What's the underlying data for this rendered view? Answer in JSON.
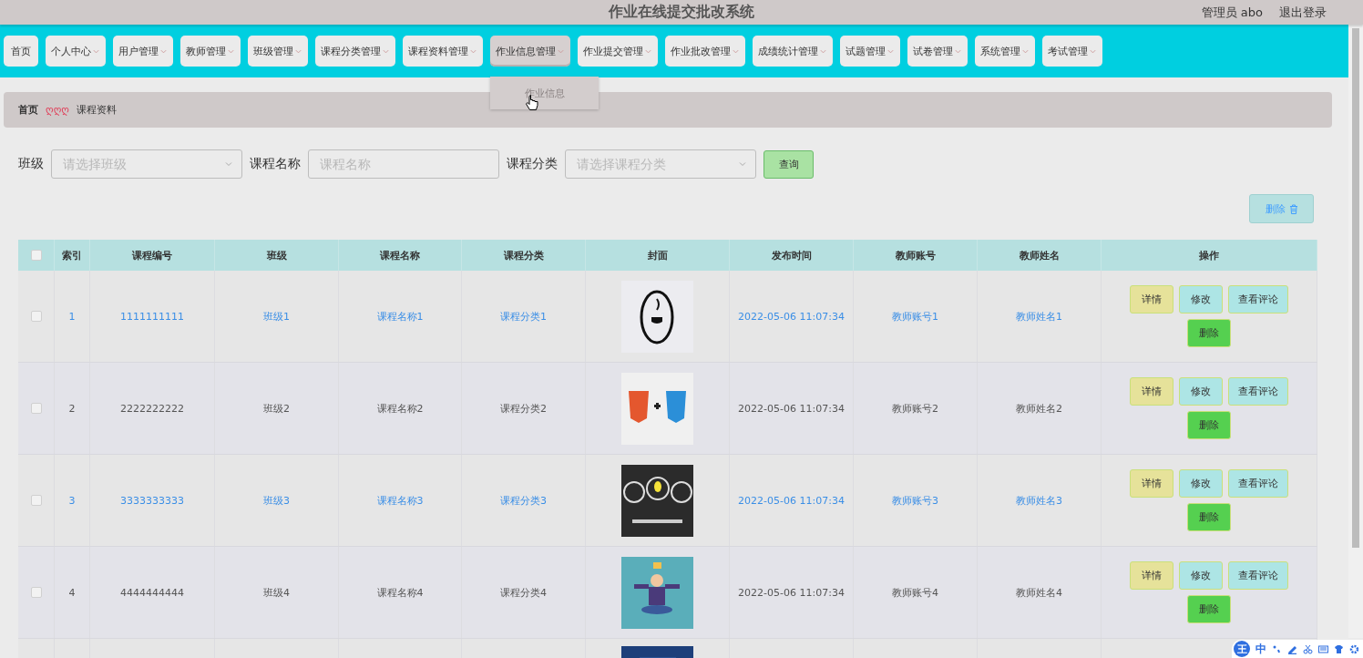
{
  "header": {
    "title": "作业在线提交批改系统",
    "user": "管理员 abo",
    "logout": "退出登录"
  },
  "nav": [
    {
      "label": "首页",
      "dropdown": false,
      "open": false
    },
    {
      "label": "个人中心",
      "dropdown": true,
      "open": false
    },
    {
      "label": "用户管理",
      "dropdown": true,
      "open": false
    },
    {
      "label": "教师管理",
      "dropdown": true,
      "open": false
    },
    {
      "label": "班级管理",
      "dropdown": true,
      "open": false
    },
    {
      "label": "课程分类管理",
      "dropdown": true,
      "open": false
    },
    {
      "label": "课程资料管理",
      "dropdown": true,
      "open": false
    },
    {
      "label": "作业信息管理",
      "dropdown": true,
      "open": true,
      "menu": [
        "作业信息"
      ]
    },
    {
      "label": "作业提交管理",
      "dropdown": true,
      "open": false
    },
    {
      "label": "作业批改管理",
      "dropdown": true,
      "open": false
    },
    {
      "label": "成绩统计管理",
      "dropdown": true,
      "open": false
    },
    {
      "label": "试题管理",
      "dropdown": true,
      "open": false
    },
    {
      "label": "试卷管理",
      "dropdown": true,
      "open": false
    },
    {
      "label": "系统管理",
      "dropdown": true,
      "open": false
    },
    {
      "label": "考试管理",
      "dropdown": true,
      "open": false
    }
  ],
  "breadcrumb": {
    "home": "首页",
    "separator": "ღღღ",
    "current": "课程资料"
  },
  "filters": [
    {
      "label": "班级",
      "kind": "select",
      "placeholder": "请选择班级"
    },
    {
      "label": "课程名称",
      "kind": "input",
      "placeholder": "课程名称"
    },
    {
      "label": "课程分类",
      "kind": "select",
      "placeholder": "请选择课程分类"
    }
  ],
  "search_button": "查询",
  "delete_button": "删除",
  "table": {
    "select_all_checked": false,
    "columns": [
      "索引",
      "课程编号",
      "班级",
      "课程名称",
      "课程分类",
      "封面",
      "发布时间",
      "教师账号",
      "教师姓名",
      "操作"
    ],
    "rows": [
      {
        "checked": false,
        "highlighted": true,
        "index": "1",
        "code": "1111111111",
        "class": "班级1",
        "name": "课程名称1",
        "category": "课程分类1",
        "time": "2022-05-06 11:07:34",
        "account": "教师账号1",
        "teacher": "教师姓名1",
        "actions": [
          "详情",
          "修改",
          "查看评论",
          "删除"
        ]
      },
      {
        "checked": false,
        "highlighted": false,
        "index": "2",
        "code": "2222222222",
        "class": "班级2",
        "name": "课程名称2",
        "category": "课程分类2",
        "time": "2022-05-06 11:07:34",
        "account": "教师账号2",
        "teacher": "教师姓名2",
        "actions": [
          "详情",
          "修改",
          "查看评论",
          "删除"
        ]
      },
      {
        "checked": false,
        "highlighted": true,
        "index": "3",
        "code": "3333333333",
        "class": "班级3",
        "name": "课程名称3",
        "category": "课程分类3",
        "time": "2022-05-06 11:07:34",
        "account": "教师账号3",
        "teacher": "教师姓名3",
        "actions": [
          "详情",
          "修改",
          "查看评论",
          "删除"
        ]
      },
      {
        "checked": false,
        "highlighted": false,
        "index": "4",
        "code": "4444444444",
        "class": "班级4",
        "name": "课程名称4",
        "category": "课程分类4",
        "time": "2022-05-06 11:07:34",
        "account": "教师账号4",
        "teacher": "教师姓名4",
        "actions": [
          "详情",
          "修改",
          "查看评论",
          "删除"
        ]
      }
    ]
  },
  "ime_bar": {
    "logo": "王",
    "mode": "中"
  }
}
